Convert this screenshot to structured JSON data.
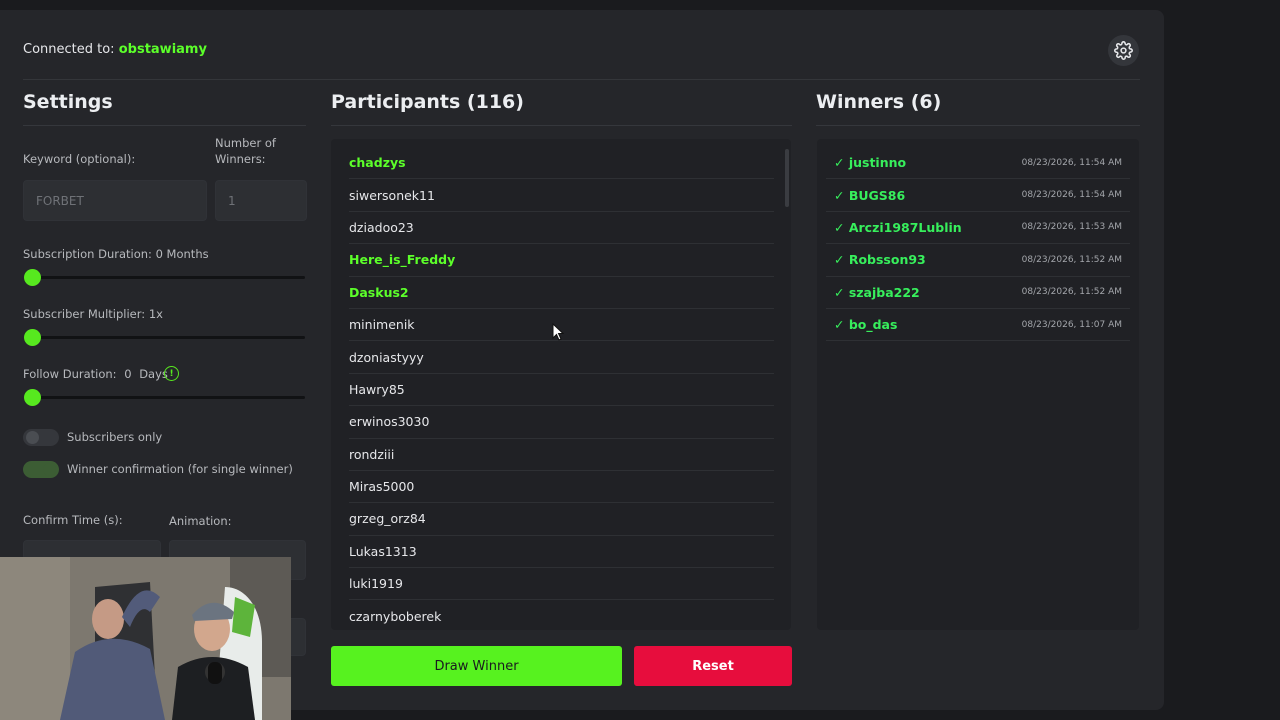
{
  "header": {
    "connected_label": "Connected to:",
    "channel": "obstawiamy"
  },
  "settings": {
    "title": "Settings",
    "keyword_label": "Keyword (optional):",
    "keyword_value": "FORBET",
    "winners_label_1": "Number of",
    "winners_label_2": "Winners:",
    "winners_value": "1",
    "sub_duration_label": "Subscription Duration: 0 Months",
    "sub_duration_value": 0,
    "sub_multiplier_label": "Subscriber Multiplier: 1x",
    "sub_multiplier_value": 1,
    "follow_label": "Follow Duration:",
    "follow_value": "0",
    "follow_unit": "Days",
    "info_glyph": "!",
    "subs_only_label": "Subscribers only",
    "subs_only": false,
    "confirm_label": "Winner confirmation (for single winner)",
    "confirm_on": true,
    "confirm_time_label": "Confirm Time (s):",
    "animation_label": "Animation:"
  },
  "participants": {
    "title": "Participants (116)",
    "items": [
      {
        "name": "chadzys",
        "highlight": true
      },
      {
        "name": "siwersonek11",
        "highlight": false
      },
      {
        "name": "dziadoo23",
        "highlight": false
      },
      {
        "name": "Here_is_Freddy",
        "highlight": true
      },
      {
        "name": "Daskus2",
        "highlight": true
      },
      {
        "name": "minimenik",
        "highlight": false
      },
      {
        "name": "dzoniastyyy",
        "highlight": false
      },
      {
        "name": "Hawry85",
        "highlight": false
      },
      {
        "name": "erwinos3030",
        "highlight": false
      },
      {
        "name": "rondziii",
        "highlight": false
      },
      {
        "name": "Miras5000",
        "highlight": false
      },
      {
        "name": "grzeg_orz84",
        "highlight": false
      },
      {
        "name": "Lukas1313",
        "highlight": false
      },
      {
        "name": "luki1919",
        "highlight": false
      },
      {
        "name": "czarnyboberek",
        "highlight": false
      }
    ]
  },
  "winners": {
    "title": "Winners (6)",
    "items": [
      {
        "name": "✓ justinno",
        "time": "08/23/2026, 11:54 AM"
      },
      {
        "name": "✓ BUGS86",
        "time": "08/23/2026, 11:54 AM"
      },
      {
        "name": "✓ Arczi1987Lublin",
        "time": "08/23/2026, 11:53 AM"
      },
      {
        "name": "✓ Robsson93",
        "time": "08/23/2026, 11:52 AM"
      },
      {
        "name": "✓ szajba222",
        "time": "08/23/2026, 11:52 AM"
      },
      {
        "name": "✓ bo_das",
        "time": "08/23/2026, 11:07 AM"
      }
    ]
  },
  "actions": {
    "draw_label": "Draw Winner",
    "reset_label": "Reset"
  },
  "colors": {
    "accent_green": "#57f21f",
    "winner_green": "#37ef5c",
    "reset_red": "#e70d3d"
  },
  "icons": {
    "settings": "gear-icon",
    "info": "info-icon",
    "cursor": "mouse-cursor-icon"
  }
}
